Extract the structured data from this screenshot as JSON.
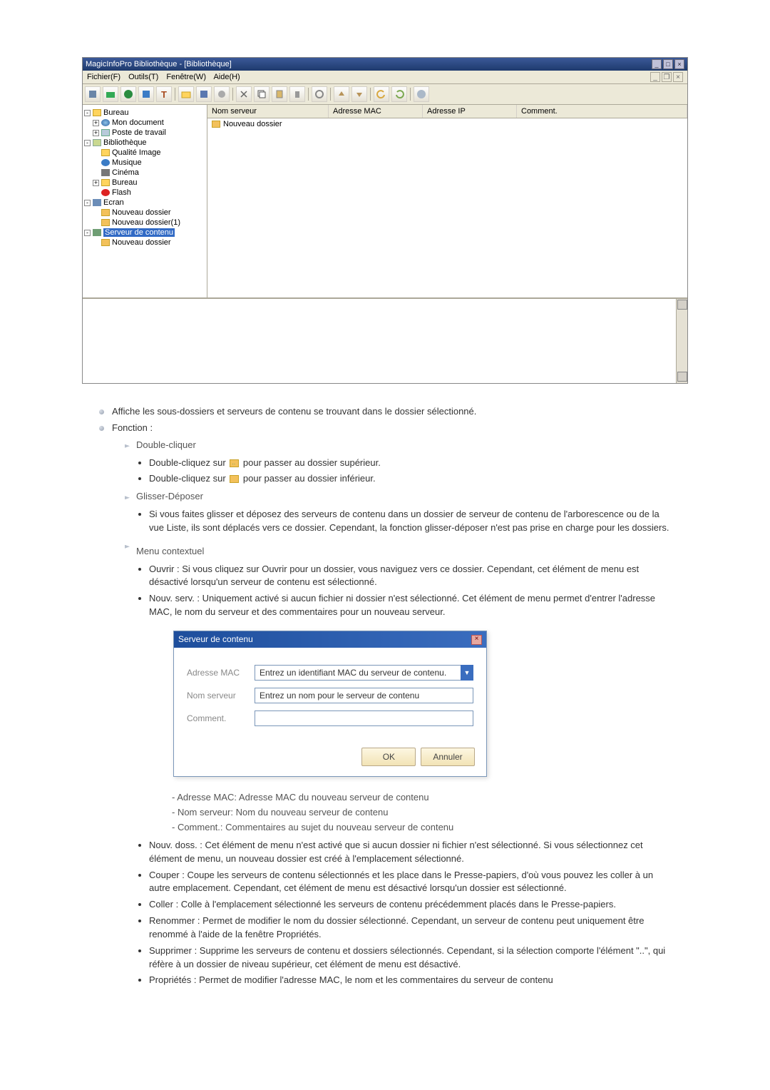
{
  "app": {
    "title": "MagicInfoPro Bibliothèque - [Bibliothèque]",
    "menus": [
      "Fichier(F)",
      "Outils(T)",
      "Fenêtre(W)",
      "Aide(H)"
    ]
  },
  "tree": {
    "bureau": "Bureau",
    "mon_doc": "Mon document",
    "poste": "Poste de travail",
    "biblio": "Bibliothèque",
    "qualite": "Qualité Image",
    "musique": "Musique",
    "cinema": "Cinéma",
    "bureau2": "Bureau",
    "flash": "Flash",
    "ecran": "Ecran",
    "nouvdoss": "Nouveau dossier",
    "nouvdoss1": "Nouveau dossier(1)",
    "serveur": "Serveur de contenu",
    "nouvdoss_srv": "Nouveau dossier"
  },
  "list": {
    "cols": {
      "name": "Nom serveur",
      "mac": "Adresse MAC",
      "ip": "Adresse IP",
      "com": "Comment."
    },
    "row0": {
      "name": "Nouveau dossier"
    }
  },
  "doc": {
    "l0": "Affiche les sous-dossiers et serveurs de contenu se trouvant dans le dossier sélectionné.",
    "fn": "Fonction :",
    "dblclick": "Double-cliquer",
    "dc1a": "Double-cliquez sur ",
    "dc1b": " pour passer au dossier supérieur.",
    "dc2a": "Double-cliquez sur ",
    "dc2b": " pour passer au dossier inférieur.",
    "drag": "Glisser-Déposer",
    "drag1": "Si vous faites glisser et déposez des serveurs de contenu dans un dossier de serveur de contenu de l'arborescence ou de la vue Liste, ils sont déplacés vers ce dossier. Cependant, la fonction glisser-déposer n'est pas prise en charge pour les dossiers.",
    "ctx": "Menu contextuel",
    "ctx1": "Ouvrir : Si vous cliquez sur Ouvrir pour un dossier, vous naviguez vers ce dossier. Cependant, cet élément de menu est désactivé lorsqu'un serveur de contenu est sélectionné.",
    "ctx2": "Nouv. serv. : Uniquement activé si aucun fichier ni dossier n'est sélectionné. Cet élément de menu permet d'entrer l'adresse MAC, le nom du serveur et des commentaires pour un nouveau serveur.",
    "dlg_mac_desc": "- Adresse MAC: Adresse MAC du nouveau serveur de contenu",
    "dlg_name_desc": "- Nom serveur: Nom du nouveau serveur de contenu",
    "dlg_com_desc": "- Comment.: Commentaires au sujet du nouveau serveur de contenu",
    "ctx3": "Nouv. doss. : Cet élément de menu n'est activé que si aucun dossier ni fichier n'est sélectionné. Si vous sélectionnez cet élément de menu, un nouveau dossier est créé à l'emplacement sélectionné.",
    "ctx4": "Couper : Coupe les serveurs de contenu sélectionnés et les place dans le Presse-papiers, d'où vous pouvez les coller à un autre emplacement. Cependant, cet élément de menu est désactivé lorsqu'un dossier est sélectionné.",
    "ctx5": "Coller : Colle à l'emplacement sélectionné les serveurs de contenu précédemment placés dans le Presse-papiers.",
    "ctx6": "Renommer : Permet de modifier le nom du dossier sélectionné. Cependant, un serveur de contenu peut uniquement être renommé à l'aide de la fenêtre Propriétés.",
    "ctx7": "Supprimer : Supprime les serveurs de contenu et dossiers sélectionnés. Cependant, si la sélection comporte l'élément \"..\", qui réfère à un dossier de niveau supérieur, cet élément de menu est désactivé.",
    "ctx8": "Propriétés : Permet de modifier l'adresse MAC, le nom et les commentaires du serveur de contenu"
  },
  "dialog": {
    "title": "Serveur de contenu",
    "mac_lbl": "Adresse MAC",
    "mac_ph": "Entrez un identifiant MAC du serveur de contenu.",
    "name_lbl": "Nom serveur",
    "name_ph": "Entrez un nom pour le serveur de contenu",
    "com_lbl": "Comment.",
    "ok": "OK",
    "cancel": "Annuler"
  }
}
